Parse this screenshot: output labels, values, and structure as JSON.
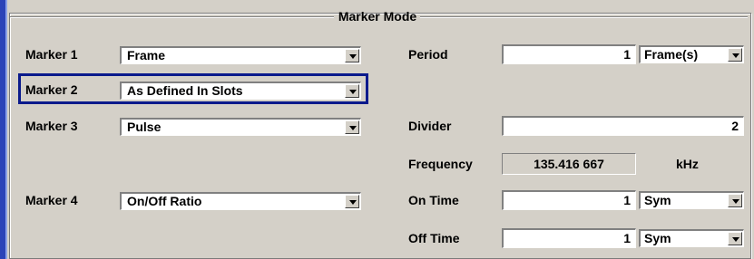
{
  "group": {
    "title": "Marker Mode"
  },
  "markers": [
    {
      "label": "Marker 1",
      "value": "Frame"
    },
    {
      "label": "Marker 2",
      "value": "As Defined In Slots"
    },
    {
      "label": "Marker 3",
      "value": "Pulse"
    },
    {
      "label": "Marker 4",
      "value": "On/Off Ratio"
    }
  ],
  "period": {
    "label": "Period",
    "value": "1",
    "unit": "Frame(s)"
  },
  "divider": {
    "label": "Divider",
    "value": "2"
  },
  "frequency": {
    "label": "Frequency",
    "value": "135.416 667",
    "unit": "kHz"
  },
  "on_time": {
    "label": "On Time",
    "value": "1",
    "unit": "Sym"
  },
  "off_time": {
    "label": "Off Time",
    "value": "1",
    "unit": "Sym"
  },
  "colors": {
    "background": "#d4d0c8",
    "focus_border": "#0a1a8c",
    "left_bar": "#2b43b8"
  }
}
